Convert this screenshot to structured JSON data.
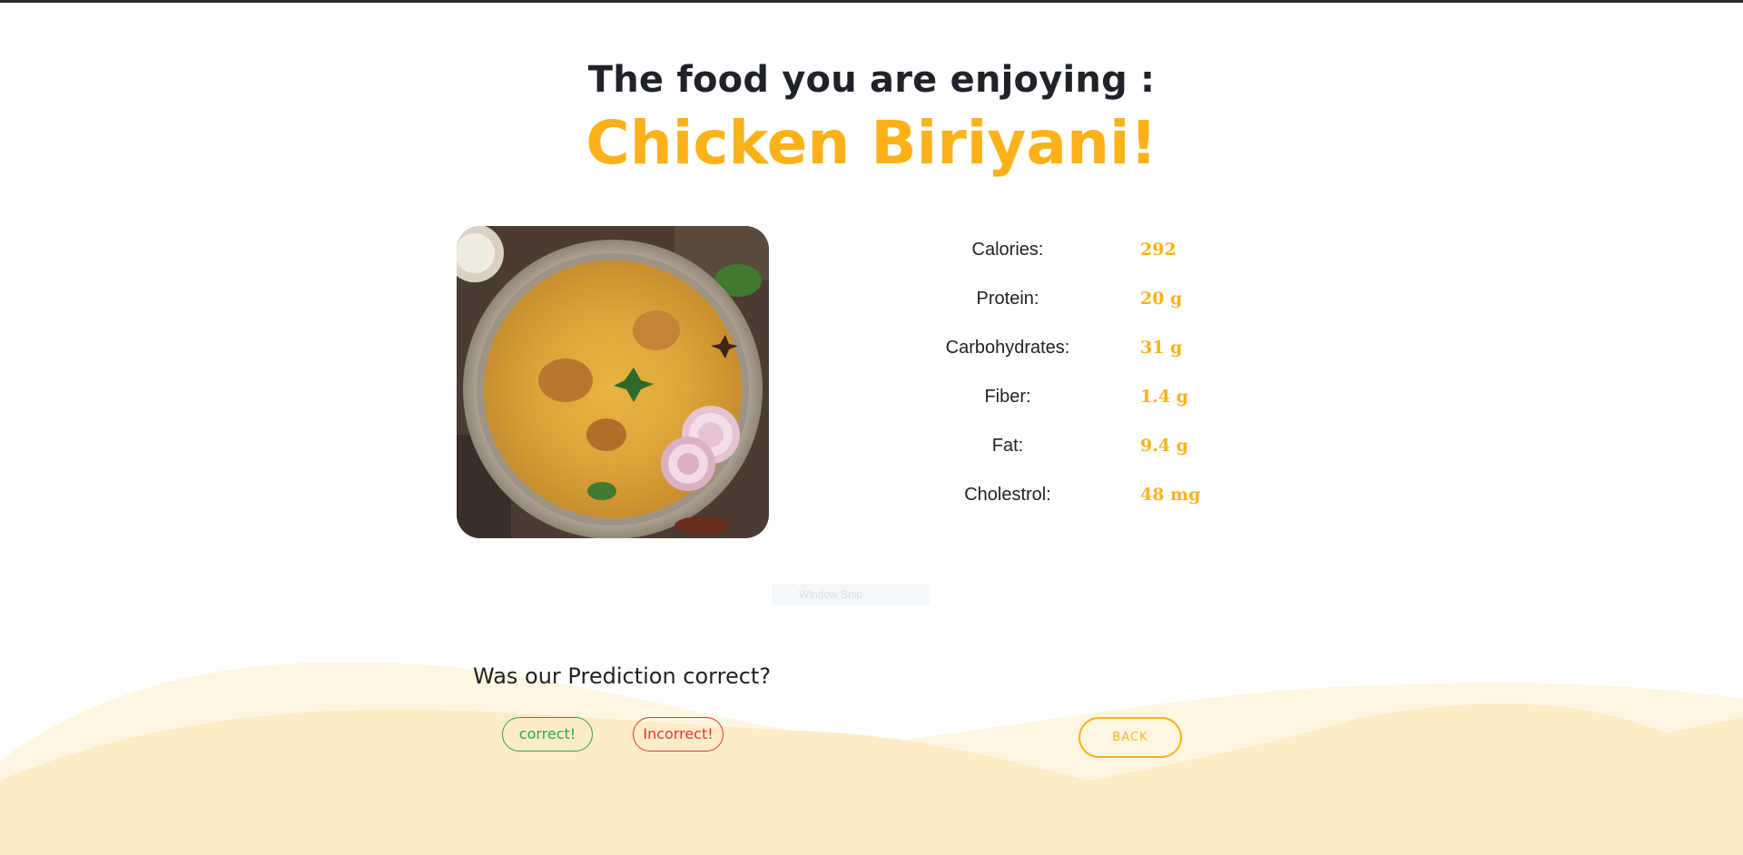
{
  "header": {
    "subtitle": "The food you are enjoying :",
    "food_name": "Chicken Biriyani!"
  },
  "food_image": {
    "icon": "biryani-plate-photo"
  },
  "nutrition": [
    {
      "label": "Calories:",
      "value": "292"
    },
    {
      "label": "Protein:",
      "value": "20 g"
    },
    {
      "label": "Carbohydrates:",
      "value": "31 g"
    },
    {
      "label": "Fiber:",
      "value": "1.4 g"
    },
    {
      "label": "Fat:",
      "value": "9.4 g"
    },
    {
      "label": "Cholestrol:",
      "value": "48 mg"
    }
  ],
  "window_hint": "Window Snip",
  "feedback": {
    "question": "Was our Prediction correct?",
    "correct_label": "correct!",
    "incorrect_label": "Incorrect!"
  },
  "navigation": {
    "back_label": "BACK"
  },
  "colors": {
    "accent": "#fbb21a",
    "heading": "#1f2329",
    "correct": "#28a745",
    "incorrect": "#dc3545",
    "wave_light": "#fff6e2",
    "wave_main": "#fdedc7"
  }
}
